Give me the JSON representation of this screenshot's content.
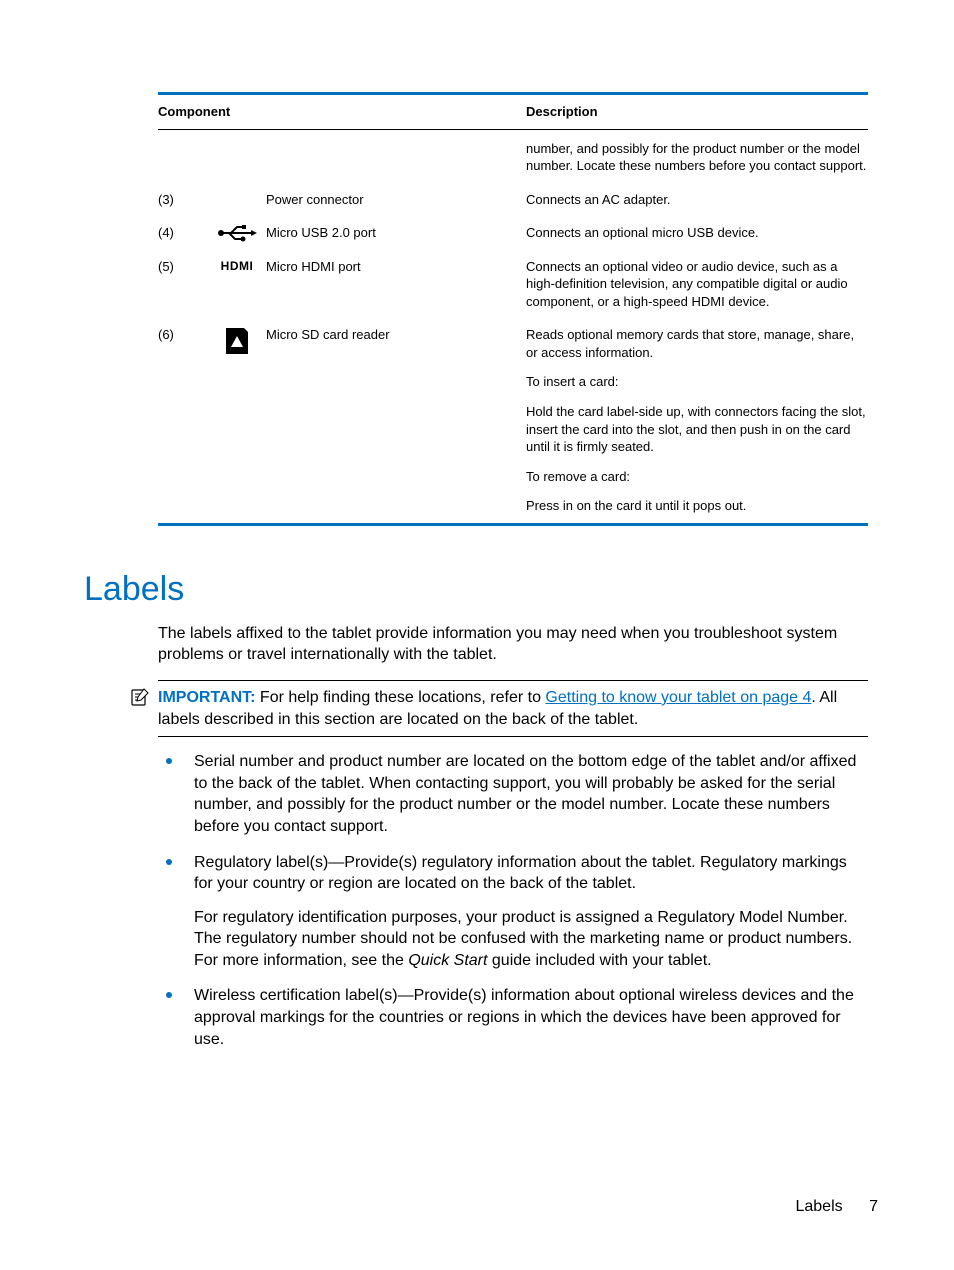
{
  "table": {
    "head": {
      "component": "Component",
      "description": "Description"
    },
    "prelude_desc": "number, and possibly for the product number or the model number. Locate these numbers before you contact support.",
    "rows": [
      {
        "num": "(3)",
        "component": "Power connector",
        "desc": [
          "Connects an AC adapter."
        ]
      },
      {
        "num": "(4)",
        "component": "Micro USB 2.0 port",
        "desc": [
          "Connects an optional micro USB device."
        ]
      },
      {
        "num": "(5)",
        "component": "Micro HDMI port",
        "desc": [
          "Connects an optional video or audio device, such as a high-definition television, any compatible digital or audio component, or a high-speed HDMI device."
        ]
      },
      {
        "num": "(6)",
        "component": "Micro SD card reader",
        "desc": [
          "Reads optional memory cards that store, manage, share, or access information.",
          "To insert a card:",
          "Hold the card label-side up, with connectors facing the slot, insert the card into the slot, and then push in on the card until it is firmly seated.",
          "To remove a card:",
          "Press in on the card it until it pops out."
        ]
      }
    ]
  },
  "heading": "Labels",
  "intro": "The labels affixed to the tablet provide information you may need when you troubleshoot system problems or travel internationally with the tablet.",
  "important": {
    "label": "IMPORTANT:",
    "pre": "For help finding these locations, refer to ",
    "link": "Getting to know your tablet on page 4",
    "post": ". All labels described in this section are located on the back of the tablet."
  },
  "bullets": [
    {
      "p1": "Serial number and product number are located on the bottom edge of the tablet and/or affixed to the back of the tablet. When contacting support, you will probably be asked for the serial number, and possibly for the product number or the model number. Locate these numbers before you contact support."
    },
    {
      "p1": "Regulatory label(s)—Provide(s) regulatory information about the tablet. Regulatory markings for your country or region are located on the back of the tablet.",
      "p2_pre": "For regulatory identification purposes, your product is assigned a Regulatory Model Number. The regulatory number should not be confused with the marketing name or product numbers. For more information, see the ",
      "p2_italic": "Quick Start",
      "p2_post": " guide included with your tablet."
    },
    {
      "p1": "Wireless certification label(s)—Provide(s) information about optional wireless devices and the approval markings for the countries or regions in which the devices have been approved for use."
    }
  ],
  "footer": {
    "section": "Labels",
    "page": "7"
  },
  "icons": {
    "hdmi_text": "HDMI"
  }
}
